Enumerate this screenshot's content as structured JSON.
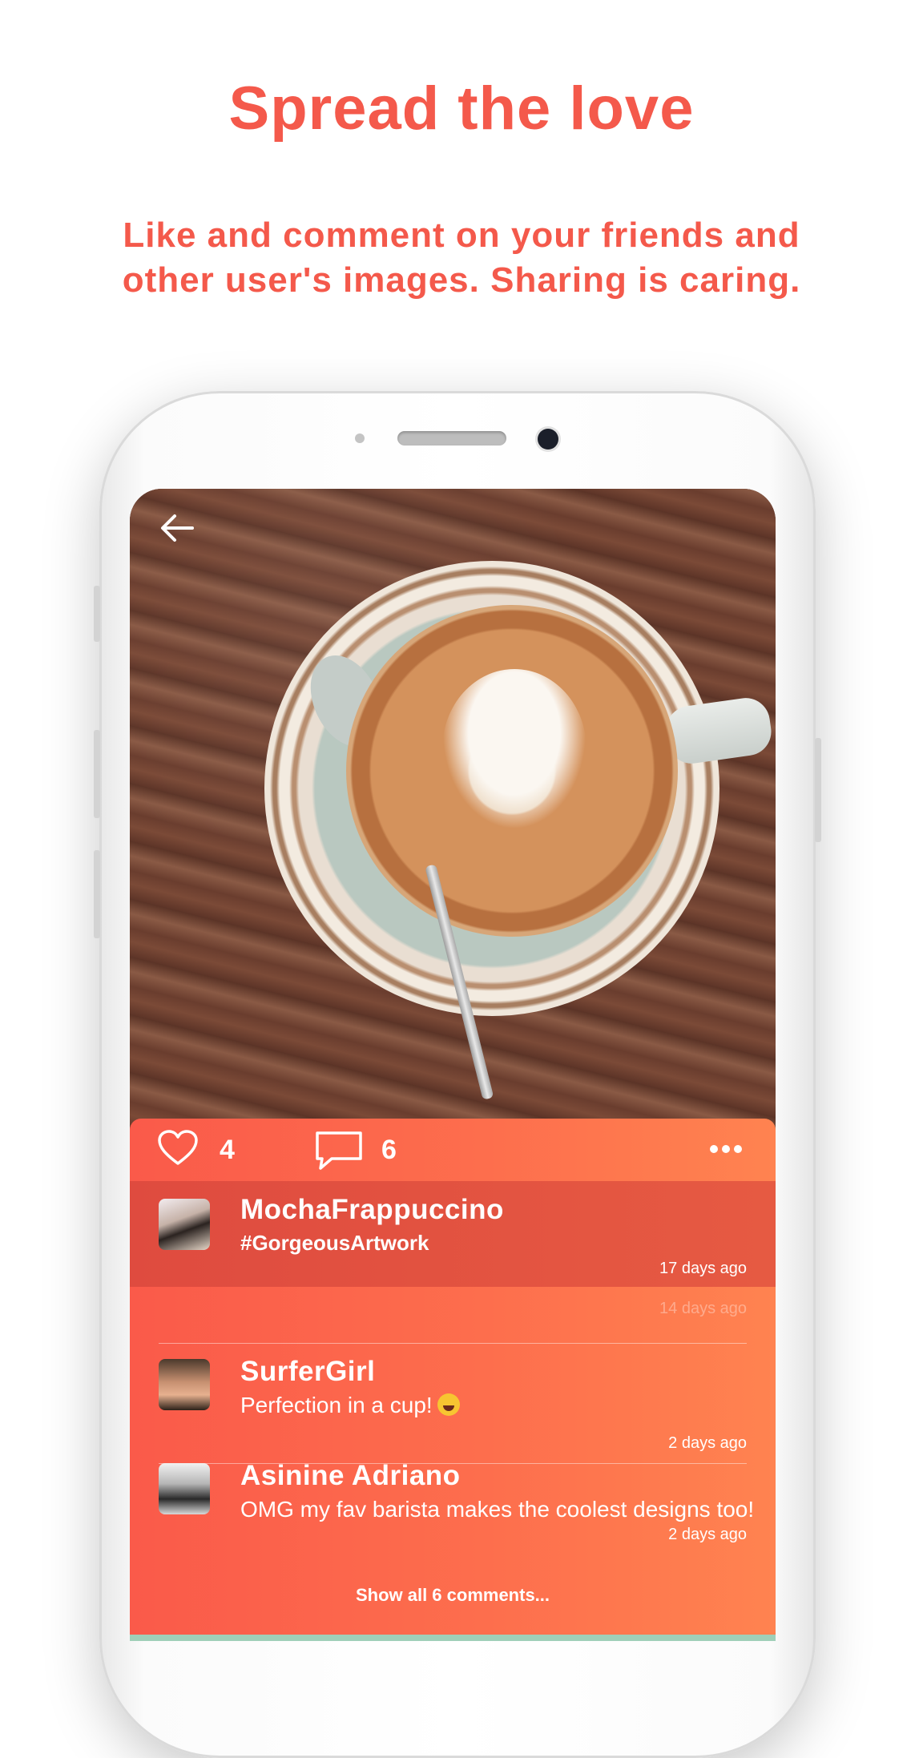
{
  "headline": "Spread the love",
  "subline": "Like and comment on your friends and other user's images. Sharing is caring.",
  "post": {
    "likes": "4",
    "comments_count": "6",
    "caption": {
      "username": "MochaFrappuccino",
      "text": "#GorgeousArtwork",
      "time": "17 days ago"
    },
    "ghost_time": "14 days ago",
    "comments": [
      {
        "username": "SurferGirl",
        "text": "Perfection in a cup!",
        "emoji": "grinning-face-emoji",
        "time": "2 days ago"
      },
      {
        "username": "Asinine Adriano",
        "text": "OMG my fav barista makes the coolest designs too!",
        "time": "2 days ago"
      }
    ],
    "show_all": "Show all 6 comments..."
  },
  "colors": {
    "accent": "#f4594b",
    "panel_left": "#fa5a4a",
    "panel_right": "#ff8350",
    "caption_bg": "#df4b3f"
  },
  "icons": [
    "back-arrow-icon",
    "heart-icon",
    "comment-icon",
    "more-options-icon"
  ]
}
